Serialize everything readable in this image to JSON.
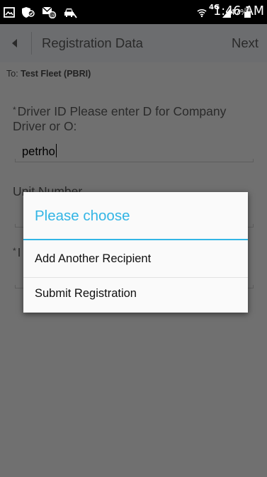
{
  "status_bar": {
    "network_label": "4G",
    "battery_percent": "47%",
    "time": "1:46 AM",
    "icons": [
      "gallery-icon",
      "shield-icon",
      "message-icon",
      "car-icon",
      "wifi-icon",
      "signal-icon",
      "battery-icon"
    ]
  },
  "app_bar": {
    "title": "Registration Data",
    "next_label": "Next",
    "back_icon": "chevron-left-icon"
  },
  "form": {
    "to_prefix": "To: ",
    "to_value": "Test Fleet (PBRI)",
    "required_marker": "*",
    "driver_id_label": "Driver ID Please enter D for Company Driver or O:",
    "driver_id_value": "petrho",
    "unit_number_label": "Unit Number",
    "third_field_label_fragment": "I"
  },
  "dialog": {
    "title": "Please choose",
    "options": [
      "Add Another Recipient",
      "Submit Registration"
    ]
  },
  "colors": {
    "status_bar_bg": "#000000",
    "app_bar_bg": "#6c6d6f",
    "content_dimmed_bg": "#707070",
    "dialog_accent": "#33b5e5",
    "dialog_bg": "#fafafa"
  }
}
